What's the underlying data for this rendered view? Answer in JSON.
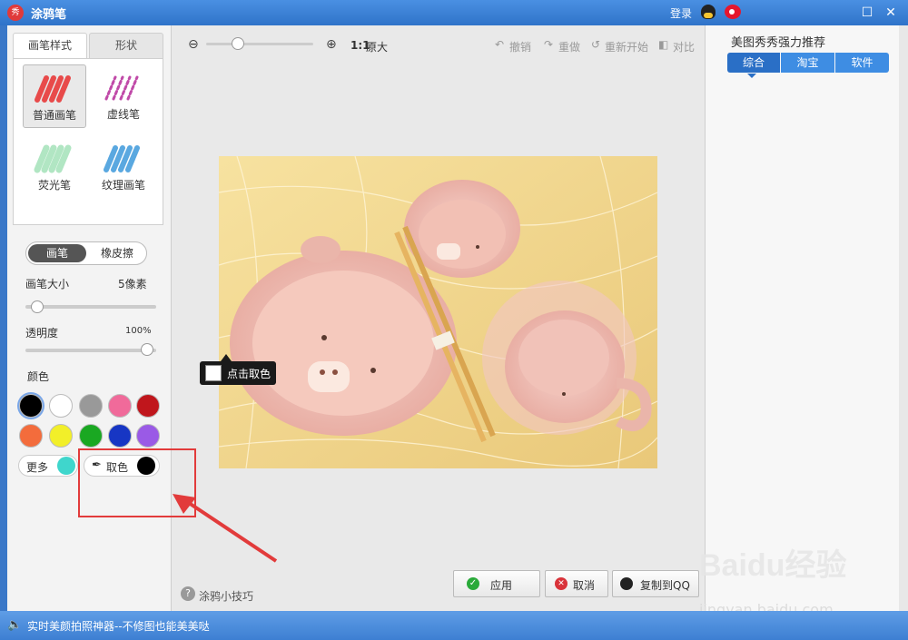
{
  "window": {
    "title": "涂鸦笔",
    "login": "登录"
  },
  "brush_tabs": [
    "画笔样式",
    "形状"
  ],
  "brushes": [
    {
      "label": "普通画笔",
      "color": "#e84a4a"
    },
    {
      "label": "虚线笔",
      "color": "#c04aa8"
    },
    {
      "label": "荧光笔",
      "color": "#9ee0b4"
    },
    {
      "label": "纹理画笔",
      "color": "#5aa8e0"
    }
  ],
  "mode": {
    "pen": "画笔",
    "eraser": "橡皮擦"
  },
  "brush_size": {
    "label": "画笔大小",
    "value": "5像素",
    "level": 0.05
  },
  "opacity": {
    "label": "透明度",
    "value": "100%",
    "level": 1.0
  },
  "color_label": "颜色",
  "colors": [
    "#000000",
    "#ffffff",
    "#999999",
    "#f06a9a",
    "#c0161c",
    "#f36c3c",
    "#f2ef29",
    "#1aa822",
    "#1736c4",
    "#9a5ae6"
  ],
  "more": {
    "label": "更多",
    "color": "#3fd6cc"
  },
  "picker": {
    "label": "取色",
    "color": "#000000"
  },
  "toolbar": {
    "zoom_label": "1:1",
    "original": "原大",
    "undo": "撤销",
    "redo": "重做",
    "restart": "重新开始",
    "compare": "对比"
  },
  "tooltip": "点击取色",
  "tips_link": "涂鸦小技巧",
  "buttons": {
    "apply": "应用",
    "cancel": "取消",
    "copy_qq": "复制到QQ"
  },
  "recommend": {
    "title": "美图秀秀强力推荐",
    "tabs": [
      "综合",
      "淘宝",
      "软件"
    ]
  },
  "status": "实时美颜拍照神器--不修图也能美美哒",
  "watermark": {
    "main": "Baidu经验",
    "sub": "jingyan.baidu.com"
  }
}
